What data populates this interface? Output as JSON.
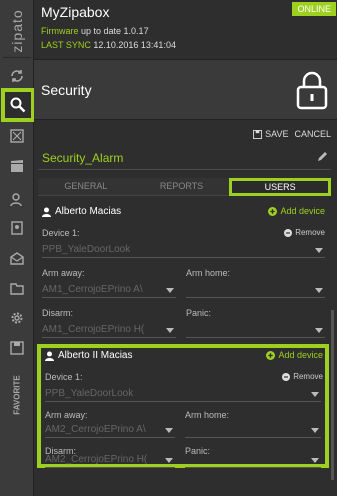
{
  "rail": {
    "logo": "zipato",
    "favorite": "FAVORITE"
  },
  "header": {
    "title": "MyZipabox",
    "firmware_label": "Firmware",
    "firmware_text": "up to date 1.0.17",
    "sync_label": "LAST SYNC",
    "sync_value": "12.10.2016 13:41:04",
    "status": "ONLINE"
  },
  "section": {
    "title": "Security"
  },
  "toolbar": {
    "save_label": "SAVE",
    "cancel_label": "CANCEL"
  },
  "alarm_name": "Security_Alarm",
  "tabs": [
    {
      "label": "GENERAL",
      "selected": false
    },
    {
      "label": "REPORTS",
      "selected": false
    },
    {
      "label": "USERS",
      "selected": true
    }
  ],
  "users": [
    {
      "name": "Alberto Macias",
      "add_label": "Add device",
      "device_label": "Device 1:",
      "remove_label": "Remove",
      "device_value": "PPB_YaleDoorLook",
      "arm_away_label": "Arm away:",
      "arm_away_value": "AM1_CerrojoEPrino A\\",
      "arm_home_label": "Arm home:",
      "arm_home_value": "",
      "disarm_label": "Disarm:",
      "disarm_value": "AM1_CerrojoEPrino H(",
      "panic_label": "Panic:",
      "panic_value": ""
    },
    {
      "name": "Alberto II Macias",
      "add_label": "Add device",
      "device_label": "Device 1:",
      "remove_label": "Remove",
      "device_value": "PPB_YaleDoorLook",
      "arm_away_label": "Arm away:",
      "arm_away_value": "AM2_CerrojoEPrino A\\",
      "arm_home_label": "Arm home:",
      "arm_home_value": "",
      "disarm_label": "Disarm:",
      "disarm_value": "AM2_CerrojoEPrino H(",
      "panic_label": "Panic:",
      "panic_value": ""
    }
  ],
  "colors": {
    "accent": "#9ed11f",
    "background": "#2b2b2b"
  }
}
